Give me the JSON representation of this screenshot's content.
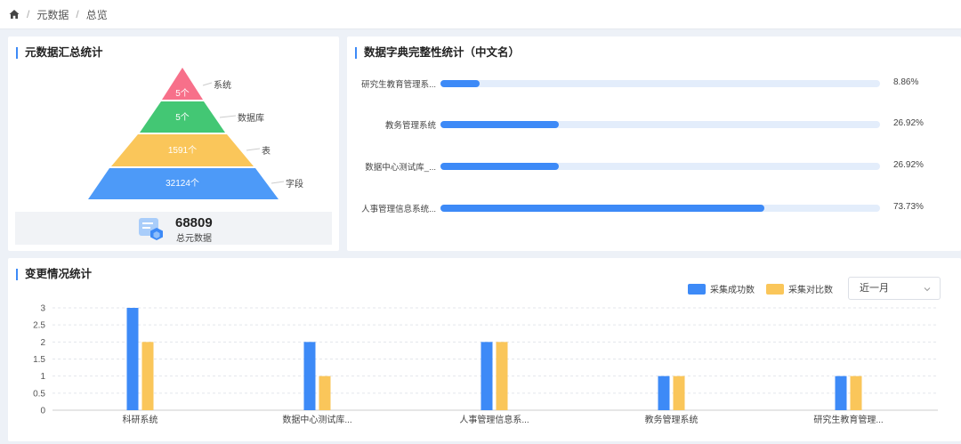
{
  "breadcrumb": {
    "items": [
      "元数据",
      "总览"
    ]
  },
  "summary": {
    "title": "元数据汇总统计",
    "levels": [
      {
        "name": "系统",
        "value": "5个",
        "color": "#f7708a"
      },
      {
        "name": "数据库",
        "value": "5个",
        "color": "#43c774"
      },
      {
        "name": "表",
        "value": "1591个",
        "color": "#fac65a"
      },
      {
        "name": "字段",
        "value": "32124个",
        "color": "#4d9af8"
      }
    ],
    "total_value": "68809",
    "total_label": "总元数据"
  },
  "dict": {
    "title": "数据字典完整性统计（中文名）",
    "rows": [
      {
        "name": "研究生教育管理系...",
        "percent": 8.86,
        "label": "8.86%"
      },
      {
        "name": "教务管理系统",
        "percent": 26.92,
        "label": "26.92%"
      },
      {
        "name": "数据中心测试库_...",
        "percent": 26.92,
        "label": "26.92%"
      },
      {
        "name": "人事管理信息系统...",
        "percent": 73.73,
        "label": "73.73%"
      }
    ]
  },
  "change": {
    "title": "变更情况统计",
    "legend": {
      "series1": "采集成功数",
      "series2": "采集对比数"
    },
    "period": {
      "selected": "近一月"
    }
  },
  "chart_data": {
    "type": "bar",
    "categories": [
      "科研系统",
      "数据中心测试库...",
      "人事管理信息系...",
      "教务管理系统",
      "研究生教育管理..."
    ],
    "series": [
      {
        "name": "采集成功数",
        "values": [
          3,
          2,
          2,
          1,
          1
        ],
        "color": "#3d8af7"
      },
      {
        "name": "采集对比数",
        "values": [
          2,
          1,
          2,
          1,
          1
        ],
        "color": "#fac65a"
      }
    ],
    "yticks": [
      "0",
      "0.5",
      "1",
      "1.5",
      "2",
      "2.5",
      "3"
    ],
    "ylim": [
      0,
      3
    ],
    "grid": true,
    "legend_position": "top-right"
  }
}
